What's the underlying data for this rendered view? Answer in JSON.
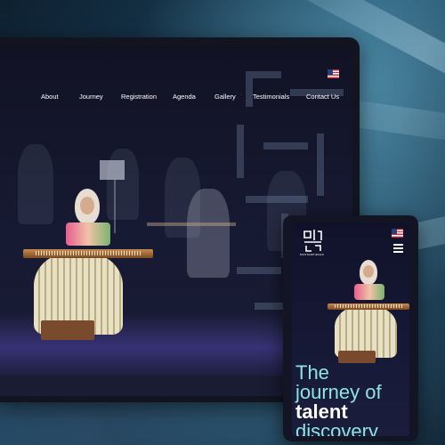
{
  "desktop": {
    "nav": {
      "items": [
        "About",
        "Journey",
        "Registration",
        "Agenda",
        "Gallery",
        "Testimonials",
        "Contact Us"
      ]
    },
    "language_flag": "us-flag-icon"
  },
  "mobile": {
    "logo_caption": "MASTERPIECES",
    "language_flag": "us-flag-icon",
    "menu_icon": "hamburger-icon",
    "hero": {
      "line1": "The",
      "line2": "journey of",
      "line3": "talent",
      "line4": "discovery"
    }
  },
  "colors": {
    "accent_teal": "#8ee4e1",
    "dark_bg": "#11122a",
    "stage_purple": "#5046aa"
  }
}
